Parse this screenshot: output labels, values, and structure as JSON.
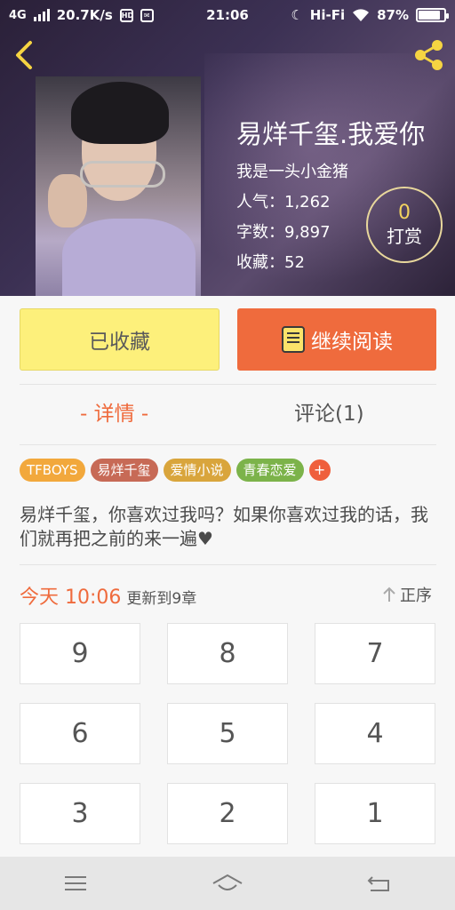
{
  "status_bar": {
    "network": "4G",
    "speed": "20.7K/s",
    "time": "21:06",
    "wifi_label": "Hi-Fi",
    "battery": "87%",
    "battery_level": 0.87
  },
  "book": {
    "title": "易烊千玺.我爱你",
    "author": "我是一头小金猪",
    "popularity": "人气：1,262",
    "words": "字数：9,897",
    "favorites": "收藏：52",
    "tip_count": "0",
    "tip_label": "打赏"
  },
  "actions": {
    "collected_label": "已收藏",
    "read_label": "继续阅读"
  },
  "tabs": [
    {
      "label": "- 详情 -"
    },
    {
      "label": "评论(1)"
    }
  ],
  "tags": [
    {
      "label": "TFBOYS",
      "color": "#f2a83c"
    },
    {
      "label": "易烊千玺",
      "color": "#c76a56"
    },
    {
      "label": "爱情小说",
      "color": "#d9a53c"
    },
    {
      "label": "青春恋爱",
      "color": "#7cb34a"
    }
  ],
  "tag_add_label": "+",
  "description": "易烊千玺，你喜欢过我吗？如果你喜欢过我的话，我们就再把之前的来一遍♥",
  "update": {
    "time": "今天 10:06",
    "text": "更新到9章",
    "sort_label": "正序"
  },
  "chapters": [
    "9",
    "8",
    "7",
    "6",
    "5",
    "4",
    "3",
    "2",
    "1"
  ],
  "colors": {
    "accent": "#ef6b3d",
    "collected_bg": "#fdf07b"
  }
}
